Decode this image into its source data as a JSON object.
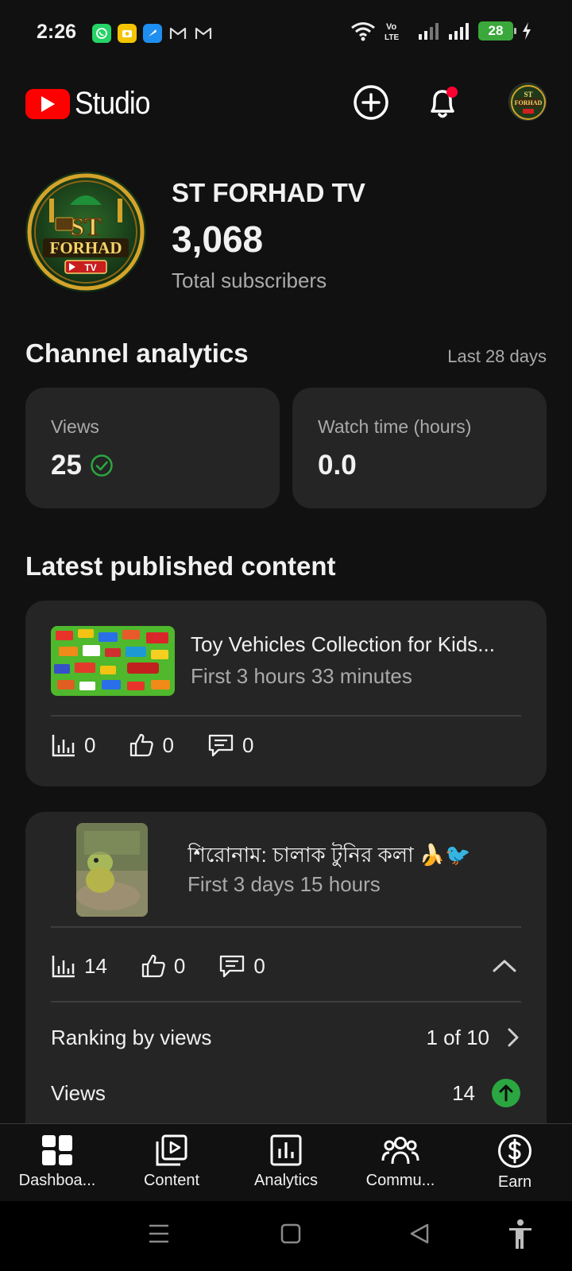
{
  "status_bar": {
    "time": "2:26",
    "battery": "28"
  },
  "header": {
    "logo_text": "Studio",
    "icons": [
      "create-icon",
      "bell-icon",
      "avatar"
    ]
  },
  "channel": {
    "name": "ST FORHAD TV",
    "subscribers": "3,068",
    "subscribers_label": "Total subscribers",
    "avatar_text_top": "ST",
    "avatar_text_mid": "FORHAD",
    "avatar_text_bot": "TV"
  },
  "analytics": {
    "title": "Channel analytics",
    "range": "Last 28 days",
    "metrics": [
      {
        "label": "Views",
        "value": "25"
      },
      {
        "label": "Watch time (hours)",
        "value": "0.0"
      }
    ]
  },
  "latest": {
    "title": "Latest published content",
    "items": [
      {
        "title": "Toy Vehicles Collection for Kids...",
        "subtitle": "First 3 hours 33 minutes",
        "views": "0",
        "likes": "0",
        "comments": "0"
      },
      {
        "title": "শিরোনাম: চালাক টুনির কলা 🍌🐦",
        "subtitle": "First 3 days 15 hours",
        "views": "14",
        "likes": "0",
        "comments": "0",
        "ranking_label": "Ranking by views",
        "ranking_value": "1 of 10",
        "views_label": "Views",
        "views_value": "14"
      }
    ]
  },
  "bottom_nav": [
    {
      "label": "Dashboa...",
      "icon": "dashboard-icon"
    },
    {
      "label": "Content",
      "icon": "content-icon"
    },
    {
      "label": "Analytics",
      "icon": "analytics-icon"
    },
    {
      "label": "Commu...",
      "icon": "community-icon"
    },
    {
      "label": "Earn",
      "icon": "earn-icon"
    }
  ],
  "colors": {
    "background": "#111111",
    "card": "#252525",
    "accent_red": "#ff0000",
    "success_green": "#2ba640",
    "notification_dot": "#ff0033"
  }
}
